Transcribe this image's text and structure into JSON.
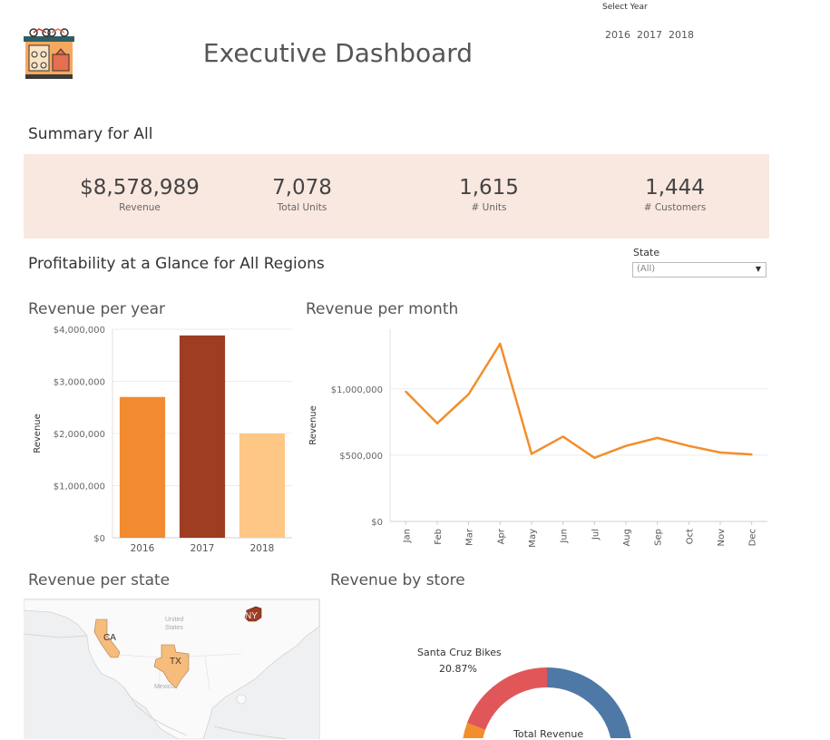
{
  "header": {
    "title": "Executive Dashboard",
    "year_filter_label": "Select Year",
    "years": [
      "2016",
      "2017",
      "2018"
    ]
  },
  "summary": {
    "title": "Summary for  All",
    "kpis": [
      {
        "value": "$8,578,989",
        "label": "Revenue"
      },
      {
        "value": "7,078",
        "label": "Total Units"
      },
      {
        "value": "1,615",
        "label": "# Units"
      },
      {
        "value": "1,444",
        "label": "# Customers"
      }
    ]
  },
  "profitability": {
    "title": "Profitability at a Glance for All Regions",
    "state_filter_label": "State",
    "state_filter_value": "(All)"
  },
  "colors": {
    "kpi_band": "#f9e8df",
    "bar_2016": "#f28a30",
    "bar_2017": "#9e3d22",
    "bar_2018": "#fec786",
    "line": "#f28e2b",
    "donut_blue": "#4e79a7",
    "donut_red": "#e15759",
    "donut_orange": "#f28e2b",
    "state_light": "#f6bc7c",
    "state_dark": "#9e3d22"
  },
  "map": {
    "title": "Revenue per state",
    "labels": {
      "us": "United States",
      "mx": "Mexico"
    },
    "states": [
      {
        "code": "CA",
        "shade": "light"
      },
      {
        "code": "TX",
        "shade": "light"
      },
      {
        "code": "NY",
        "shade": "dark"
      }
    ]
  },
  "store_chart": {
    "title": "Revenue by store",
    "highlight_store": "Santa Cruz Bikes",
    "highlight_pct": "20.87%",
    "center_label": "Total Revenue"
  },
  "chart_data": [
    {
      "type": "bar",
      "title": "Revenue per year",
      "ylabel": "Revenue",
      "categories": [
        "2016",
        "2017",
        "2018"
      ],
      "values": [
        2700000,
        3880000,
        2000000
      ],
      "ylim": [
        0,
        4000000
      ],
      "yticks": [
        0,
        1000000,
        2000000,
        3000000,
        4000000
      ],
      "ytick_labels": [
        "$0",
        "$1,000,000",
        "$2,000,000",
        "$3,000,000",
        "$4,000,000"
      ],
      "bar_colors": [
        "#f28a30",
        "#9e3d22",
        "#fec786"
      ]
    },
    {
      "type": "line",
      "title": "Revenue per month",
      "ylabel": "Revenue",
      "categories": [
        "Jan",
        "Feb",
        "Mar",
        "Apr",
        "May",
        "Jun",
        "Jul",
        "Aug",
        "Sep",
        "Oct",
        "Nov",
        "Dec"
      ],
      "values": [
        980000,
        740000,
        960000,
        1340000,
        510000,
        640000,
        480000,
        570000,
        630000,
        570000,
        520000,
        505000
      ],
      "ylim": [
        0,
        1450000
      ],
      "yticks": [
        0,
        500000,
        1000000
      ],
      "ytick_labels": [
        "$0",
        "$500,000",
        "$1,000,000"
      ]
    },
    {
      "type": "pie",
      "title": "Revenue by store",
      "slices": [
        {
          "name": "Santa Cruz Bikes",
          "value": 20.87,
          "color": "#e15759"
        }
      ]
    }
  ]
}
